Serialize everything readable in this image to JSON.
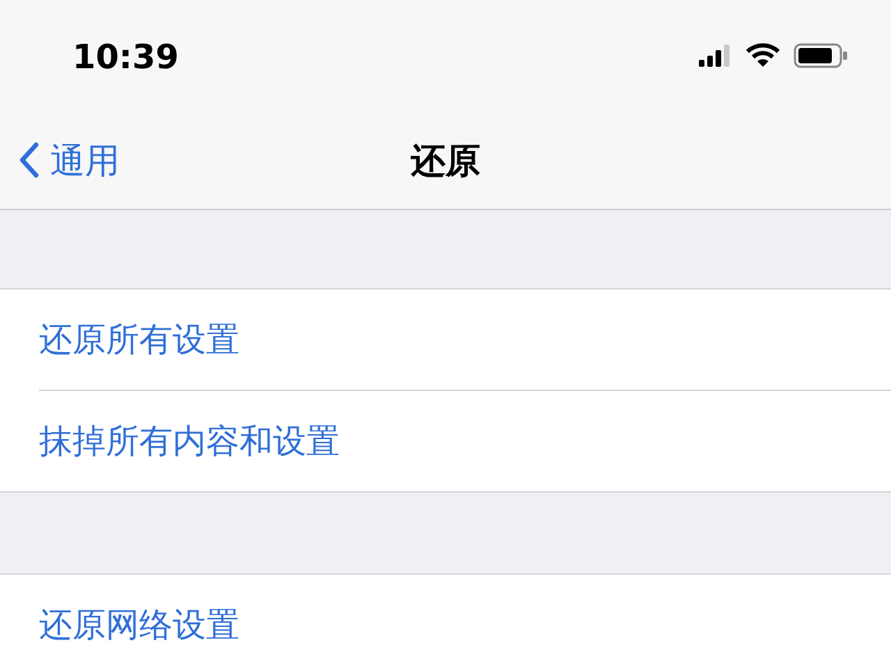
{
  "status_bar": {
    "time": "10:39"
  },
  "nav": {
    "back_label": "通用",
    "title": "还原"
  },
  "groups": [
    {
      "items": [
        {
          "label": "还原所有设置"
        },
        {
          "label": "抹掉所有内容和设置"
        }
      ]
    },
    {
      "items": [
        {
          "label": "还原网络设置"
        }
      ]
    }
  ]
}
